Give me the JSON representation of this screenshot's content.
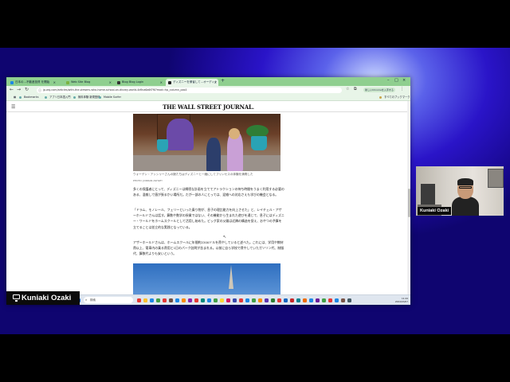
{
  "browser": {
    "tabs": [
      {
        "label": "日本の…不動産投資 を開始"
      },
      {
        "label": "Web Site Blog"
      },
      {
        "label": "Blog Blog Login"
      },
      {
        "label": "ディズニーを帰省して…オーディナ"
      }
    ],
    "new_tab_label": "+",
    "url": "jp.wsj.com/articles/with-the-viewers-who-home-school-on-disney-world-4d9ca6a6f7f0?mod=hp_column_pos4",
    "profile_pill": "新しいChromeを入手する",
    "bookmarks": [
      {
        "label": "Bookmarks"
      },
      {
        "label": "アプリ日本語入門"
      },
      {
        "label": "無料体験 新規登録"
      },
      {
        "label": "Mobile Surfer"
      }
    ],
    "bookmarks_right": "すべてのブックマーク"
  },
  "article": {
    "masthead": "THE WALL STREET JOURNAL.",
    "caption": "ウォーデン・アッシリーさんの娘たちはディズニーと一緒にしてプリンセスの体験を満喫した",
    "credit": "PHOTO: JORDAN ASHLEY",
    "paragraphs": [
      "多くの保護者にとって、ディズニーは綿密な計画を立ててアトラクションの待ち時間をうまく利用する必要のある、混雑して値が張るかい場所だ。だが一部の人にとっては、混雑への対応さえも学びの機会となる。",
      "「ドラム、モノレール、フェリーといった乗り物が、息子の理比能力を向上させた」と、レイチェル・アザーホールドさんは話す。算数や数学の授業ではない、その機能から生まれた遊びを通じて、息子にはディズニー・ワールドをホームスクールとして活用し始めた。ビッグ家の父親は近隣の構造を捉え、おやつの予算を立てることは並立的な実践となっている。",
      "アザーホールドさんは、ホームスクールに年間約2200ドルを費やしていると述べた。これには、学用や教材費以上、電車内の乗る費用と1日のパーク訪問が含まれる。以前に自ら学校で費やしていたガソリン代、制服代、算数代よりも安いという。"
    ]
  },
  "taskbar": {
    "search_placeholder": "検索",
    "time": "11:44",
    "date": "2024/03/07"
  },
  "presenter": {
    "screen_name": "Kuniaki Ozaki",
    "camera_name": "Kuniaki Ozaki"
  }
}
